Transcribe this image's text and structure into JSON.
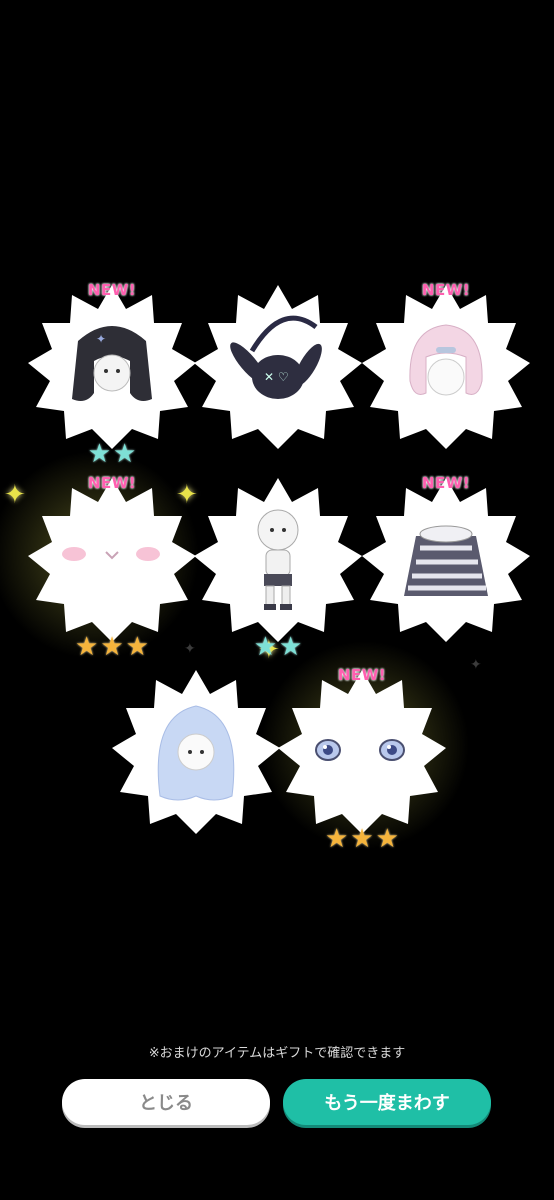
{
  "items": [
    {
      "name": "black cat hood",
      "new_label": "NEW!",
      "stars": 2,
      "star_color": "#7ee0d6"
    },
    {
      "name": "bunny bag",
      "new_label": "",
      "stars": 0,
      "star_color": ""
    },
    {
      "name": "pink bob hair",
      "new_label": "NEW!",
      "stars": 0,
      "star_color": ""
    },
    {
      "name": "blush face",
      "new_label": "NEW!",
      "stars": 3,
      "star_color": "#f5b43c"
    },
    {
      "name": "body outfit",
      "new_label": "",
      "stars": 2,
      "star_color": "#7ee0d6"
    },
    {
      "name": "striped dress",
      "new_label": "NEW!",
      "stars": 0,
      "star_color": ""
    },
    {
      "name": "blue long hair",
      "new_label": "",
      "stars": 0,
      "star_color": ""
    },
    {
      "name": "blue eyes",
      "new_label": "NEW!",
      "stars": 3,
      "star_color": "#f5b43c"
    }
  ],
  "note": "※おまけのアイテムはギフトで確認できます",
  "buttons": {
    "close": "とじる",
    "again": "もう一度まわす"
  },
  "colors": {
    "accent": "#1fbfa6",
    "new_text": "#ff5fb0",
    "background": "#000000"
  }
}
